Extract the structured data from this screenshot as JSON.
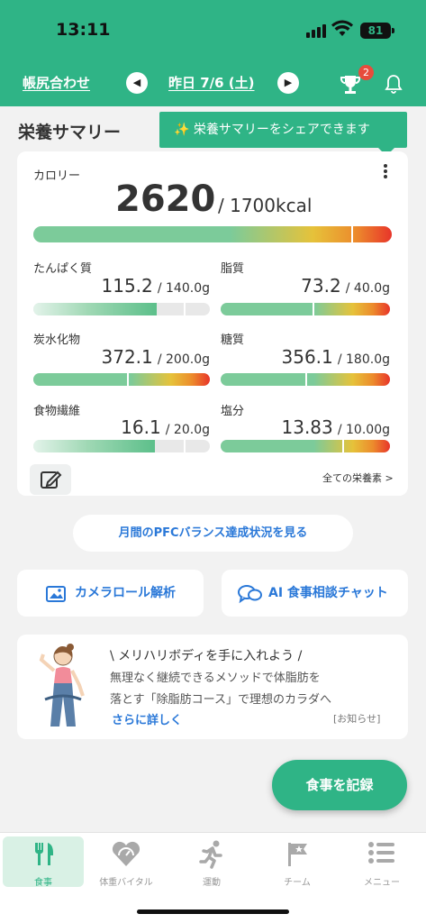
{
  "status": {
    "time": "13:11",
    "battery": "81"
  },
  "header": {
    "ledger_link": "帳尻合わせ",
    "prev_icon": "chevron-left-icon",
    "date_label": "昨日 7/6 (土)",
    "next_icon": "chevron-right-icon",
    "trophy_badge": "2",
    "accent": "#2fb486"
  },
  "summary": {
    "title": "栄養サマリー",
    "share_tooltip": "✨ 栄養サマリーをシェアできます",
    "calorie_label": "カロリー",
    "calorie_value": "2620",
    "calorie_goal": "/ 1700kcal",
    "calorie_ratio": 1.54
  },
  "nutrients": [
    {
      "name": "たんぱく質",
      "value": "115.2",
      "goal": "/ 140.0g",
      "ratio": 0.82
    },
    {
      "name": "脂質",
      "value": "73.2",
      "goal": "/ 40.0g",
      "ratio": 1.83
    },
    {
      "name": "炭水化物",
      "value": "372.1",
      "goal": "/ 200.0g",
      "ratio": 1.86
    },
    {
      "name": "糖質",
      "value": "356.1",
      "goal": "/ 180.0g",
      "ratio": 1.98
    },
    {
      "name": "食物繊維",
      "value": "16.1",
      "goal": "/ 20.0g",
      "ratio": 0.81
    },
    {
      "name": "塩分",
      "value": "13.83",
      "goal": "/ 10.00g",
      "ratio": 1.38
    }
  ],
  "all_nutrients_link": "全ての栄養素 >",
  "pfc_button": "月間のPFCバランス達成状況を見る",
  "actions": {
    "camera_roll": "カメラロール解析",
    "ai_chat": "AI 食事相談チャット"
  },
  "promo": {
    "title": "\\ メリハリボディを手に入れよう /",
    "line1": "無理なく継続できるメソッドで体脂肪を",
    "line2": "落とす「除脂肪コース」で理想のカラダへ",
    "more": "さらに詳しく",
    "tag": "[お知らせ]"
  },
  "fab": "食事を記録",
  "tabs": [
    {
      "label": "食事",
      "icon": "fork-knife-icon",
      "active": true
    },
    {
      "label": "体重バイタル",
      "icon": "heart-gauge-icon",
      "active": false
    },
    {
      "label": "運動",
      "icon": "running-icon",
      "active": false
    },
    {
      "label": "チーム",
      "icon": "flag-icon",
      "active": false
    },
    {
      "label": "メニュー",
      "icon": "menu-list-icon",
      "active": false
    }
  ]
}
